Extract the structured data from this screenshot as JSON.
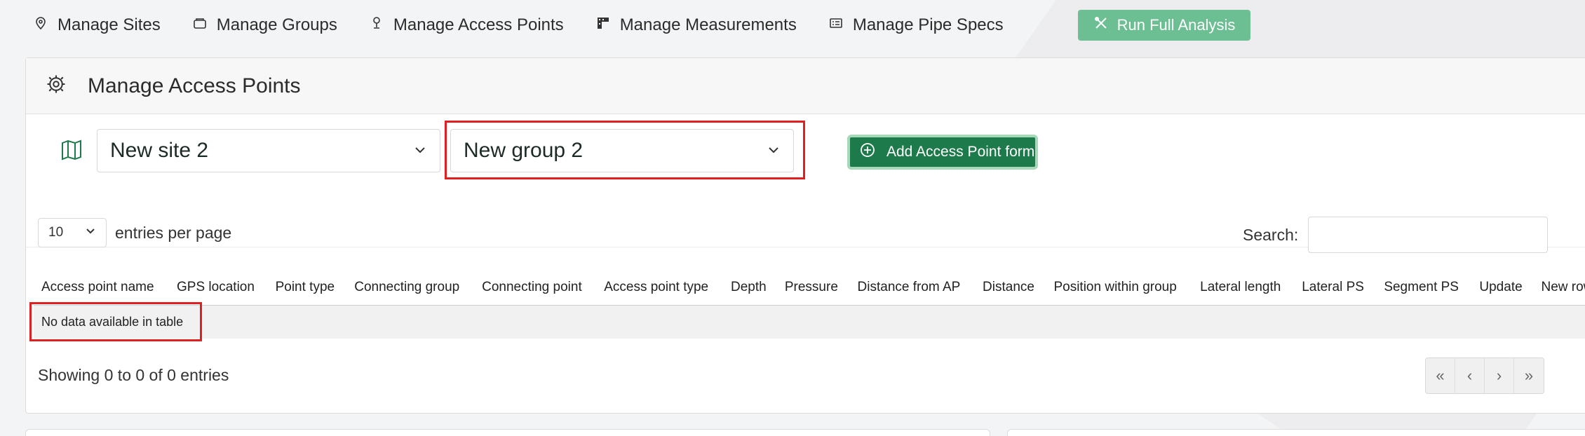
{
  "nav": {
    "items": [
      {
        "label": "Manage Sites",
        "icon": "location-pin-icon"
      },
      {
        "label": "Manage Groups",
        "icon": "folder-icon"
      },
      {
        "label": "Manage Access Points",
        "icon": "access-point-icon"
      },
      {
        "label": "Manage Measurements",
        "icon": "ruler-icon"
      },
      {
        "label": "Manage Pipe Specs",
        "icon": "list-card-icon"
      }
    ],
    "run_label": "Run Full Analysis",
    "run_icon": "tools-icon"
  },
  "card": {
    "title": "Manage Access Points",
    "title_icon": "gear-icon"
  },
  "filters": {
    "map_icon": "map-icon",
    "site_value": "New site 2",
    "group_value": "New group 2",
    "add_label": "Add Access Point form"
  },
  "table_controls": {
    "entries_value": "10",
    "entries_label": "entries per page",
    "search_label": "Search:",
    "search_value": ""
  },
  "table": {
    "columns": [
      "Access point name",
      "GPS location",
      "Point type",
      "Connecting group",
      "Connecting point",
      "Access point type",
      "Depth",
      "Pressure",
      "Distance from AP",
      "Distance",
      "Position within group",
      "Lateral length",
      "Lateral PS",
      "Segment PS",
      "Update",
      "New row"
    ],
    "empty_message": "No data available in table"
  },
  "footer": {
    "showing": "Showing 0 to 0 of 0 entries",
    "pager": [
      "«",
      "‹",
      "›",
      "»"
    ]
  },
  "colors": {
    "accent_green": "#1d7a4a",
    "run_button": "#6cbf92",
    "highlight_red": "#e02020"
  }
}
